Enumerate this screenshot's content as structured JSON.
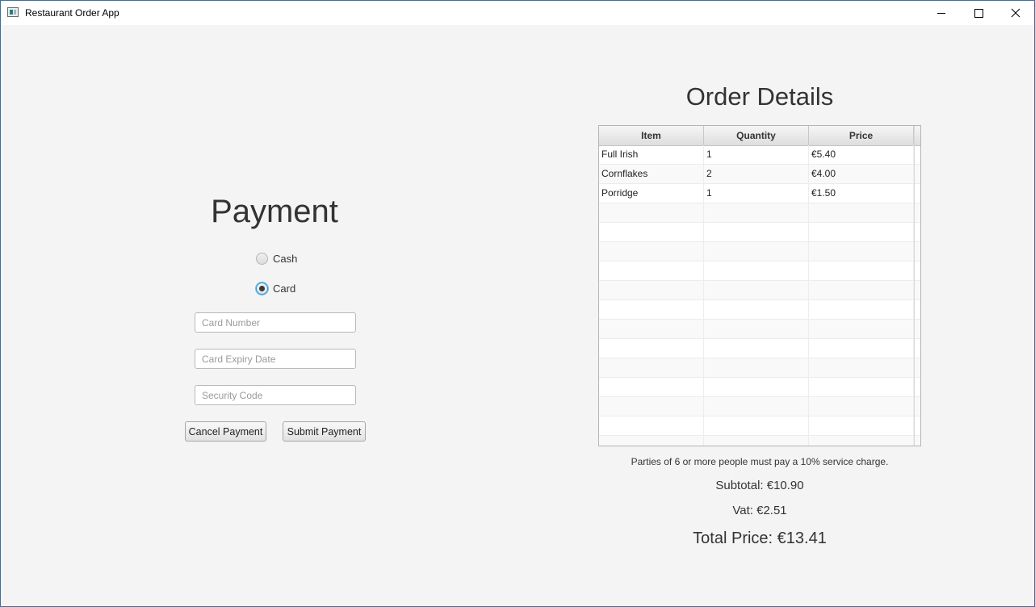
{
  "window": {
    "title": "Restaurant Order App",
    "icon": "app-window-icon",
    "controls": [
      "minimize-icon",
      "maximize-icon",
      "close-icon"
    ]
  },
  "payment": {
    "title": "Payment",
    "options": [
      {
        "label": "Cash",
        "selected": false
      },
      {
        "label": "Card",
        "selected": true
      }
    ],
    "fields": {
      "card_number": {
        "placeholder": "Card Number",
        "value": ""
      },
      "card_expiry": {
        "placeholder": "Card Expiry Date",
        "value": ""
      },
      "security_code": {
        "placeholder": "Security Code",
        "value": ""
      }
    },
    "buttons": {
      "cancel": "Cancel Payment",
      "submit": "Submit Payment"
    }
  },
  "order": {
    "title": "Order Details",
    "columns": [
      "Item",
      "Quantity",
      "Price"
    ],
    "rows": [
      [
        "Full Irish",
        "1",
        "€5.40"
      ],
      [
        "Cornflakes",
        "2",
        "€4.00"
      ],
      [
        "Porridge",
        "1",
        "€1.50"
      ]
    ],
    "note": "Parties of 6 or more people must pay a 10% service charge.",
    "subtotal": "Subtotal: €10.90",
    "vat": "Vat: €2.51",
    "total": "Total Price: €13.41"
  },
  "colors": {
    "window_border": "#3c6e9e",
    "background": "#f4f4f4",
    "radio_focus": "#1f93d8"
  }
}
